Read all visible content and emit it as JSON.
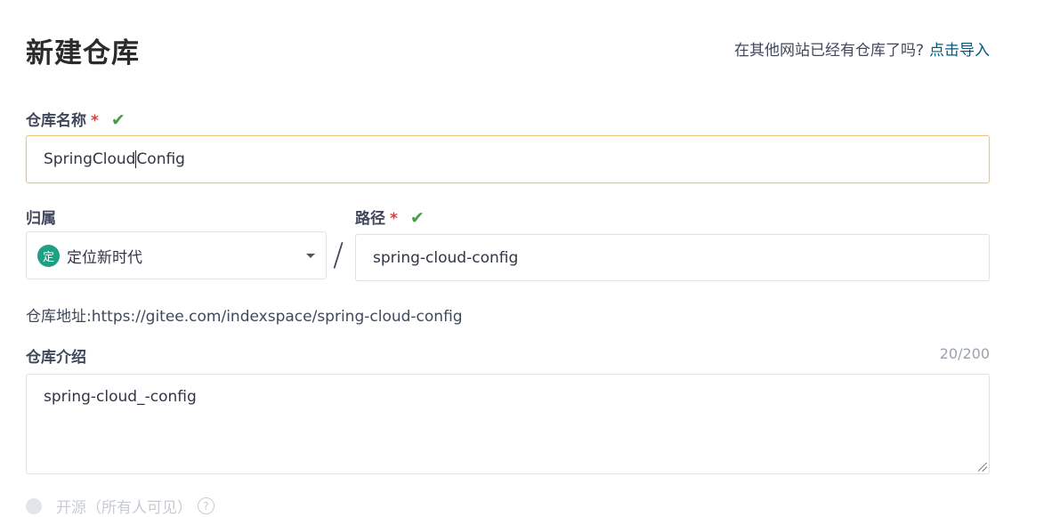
{
  "header": {
    "title": "新建仓库",
    "import_hint": "在其他网站已经有仓库了吗?",
    "import_link": "点击导入"
  },
  "form": {
    "repo_name": {
      "label": "仓库名称",
      "required_mark": "*",
      "valid_icon": "check-icon",
      "value_before_cursor": "SpringCloud",
      "value_after_cursor": "Config"
    },
    "owner": {
      "label": "归属",
      "avatar_text": "定",
      "value": "定位新时代"
    },
    "separator": "/",
    "path": {
      "label": "路径",
      "required_mark": "*",
      "valid_icon": "check-icon",
      "value": "spring-cloud-config"
    },
    "repo_url": {
      "label": "仓库地址:",
      "value": "https://gitee.com/indexspace/spring-cloud-config"
    },
    "description": {
      "label": "仓库介绍",
      "counter": "20/200",
      "value": "spring-cloud_-config"
    },
    "visibility": {
      "option_label": "开源（所有人可见）",
      "help_icon": "question-circle-icon"
    }
  },
  "colors": {
    "valid_check": "#43a047",
    "required": "#e53935",
    "link": "#005980",
    "focus_border": "#f0c27b",
    "avatar_bg": "#1fa085"
  }
}
